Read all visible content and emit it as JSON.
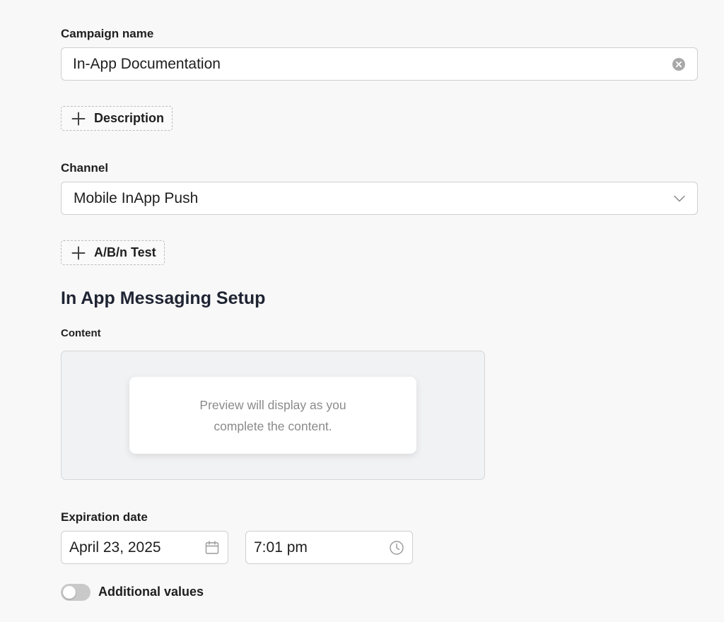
{
  "campaign": {
    "name_label": "Campaign name",
    "name_value": "In-App Documentation",
    "description_button": "Description"
  },
  "channel": {
    "label": "Channel",
    "selected": "Mobile InApp Push",
    "ab_test_button": "A/B/n Test"
  },
  "setup": {
    "title": "In App Messaging Setup",
    "content_label": "Content",
    "preview_text": "Preview will display as you complete the content."
  },
  "expiration": {
    "label": "Expiration date",
    "date": "April 23, 2025",
    "time": "7:01 pm"
  },
  "additional": {
    "toggle_label": "Additional values",
    "toggle_on": false
  },
  "icons": {
    "clear": "clear-icon",
    "chevron": "chevron-down-icon",
    "plus": "plus-icon",
    "calendar": "calendar-icon",
    "clock": "clock-icon"
  },
  "colors": {
    "background": "#f8f8f8",
    "border": "#cfcfcf",
    "muted_text": "#8a8a8a",
    "toggle_off": "#c9c9c9"
  }
}
